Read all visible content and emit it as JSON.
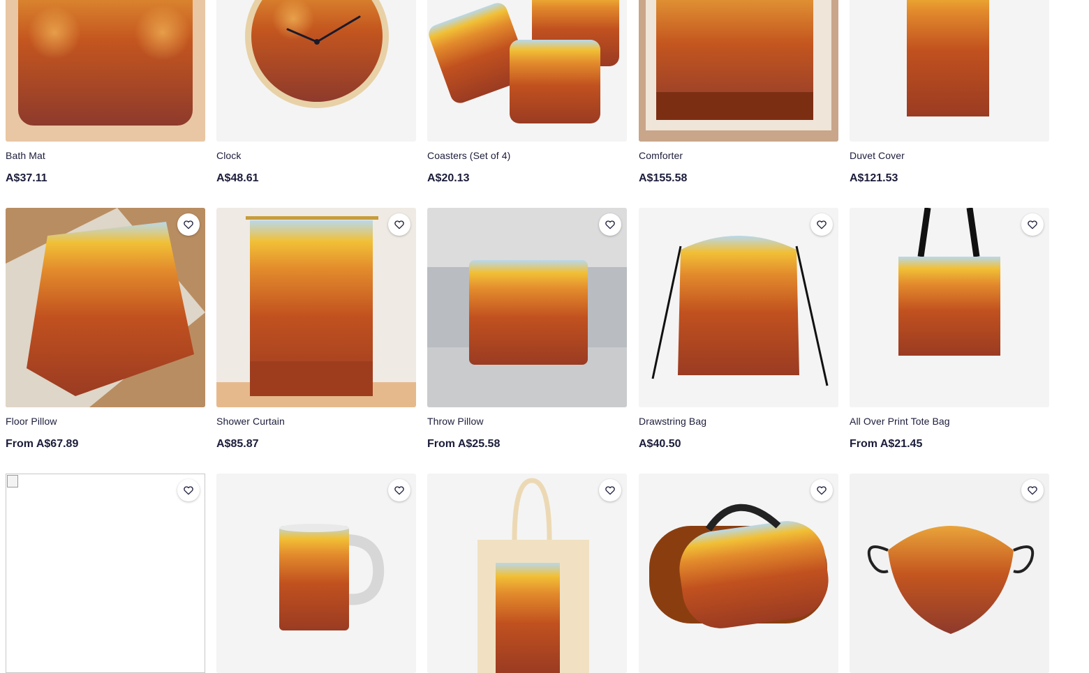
{
  "brand_colors": {
    "text": "#1b1c3a",
    "art_orange": "#c95a24",
    "art_rust": "#a8401d",
    "art_yellow": "#f1c036",
    "art_sky": "#b9d8ea"
  },
  "favorite_icon": "heart-outline-icon",
  "products": [
    {
      "title": "Bath Mat",
      "price": "A$37.11",
      "icon": "bath-mat-image"
    },
    {
      "title": "Clock",
      "price": "A$48.61",
      "icon": "clock-image"
    },
    {
      "title": "Coasters (Set of 4)",
      "price": "A$20.13",
      "icon": "coasters-image"
    },
    {
      "title": "Comforter",
      "price": "A$155.58",
      "icon": "comforter-image"
    },
    {
      "title": "Duvet Cover",
      "price": "A$121.53",
      "icon": "duvet-cover-image"
    },
    {
      "title": "Floor Pillow",
      "price": "From A$67.89",
      "icon": "floor-pillow-image"
    },
    {
      "title": "Shower Curtain",
      "price": "A$85.87",
      "icon": "shower-curtain-image"
    },
    {
      "title": "Throw Pillow",
      "price": "From A$25.58",
      "icon": "throw-pillow-image"
    },
    {
      "title": "Drawstring Bag",
      "price": "A$40.50",
      "icon": "drawstring-bag-image"
    },
    {
      "title": "All Over Print Tote Bag",
      "price": "From A$21.45",
      "icon": "tote-bag-image"
    },
    {
      "title": "",
      "price": "",
      "icon": "broken-image"
    },
    {
      "title": "",
      "price": "",
      "icon": "mug-image"
    },
    {
      "title": "",
      "price": "",
      "icon": "cotton-tote-bag-image"
    },
    {
      "title": "",
      "price": "",
      "icon": "duffle-bag-image"
    },
    {
      "title": "",
      "price": "",
      "icon": "face-mask-image"
    }
  ]
}
